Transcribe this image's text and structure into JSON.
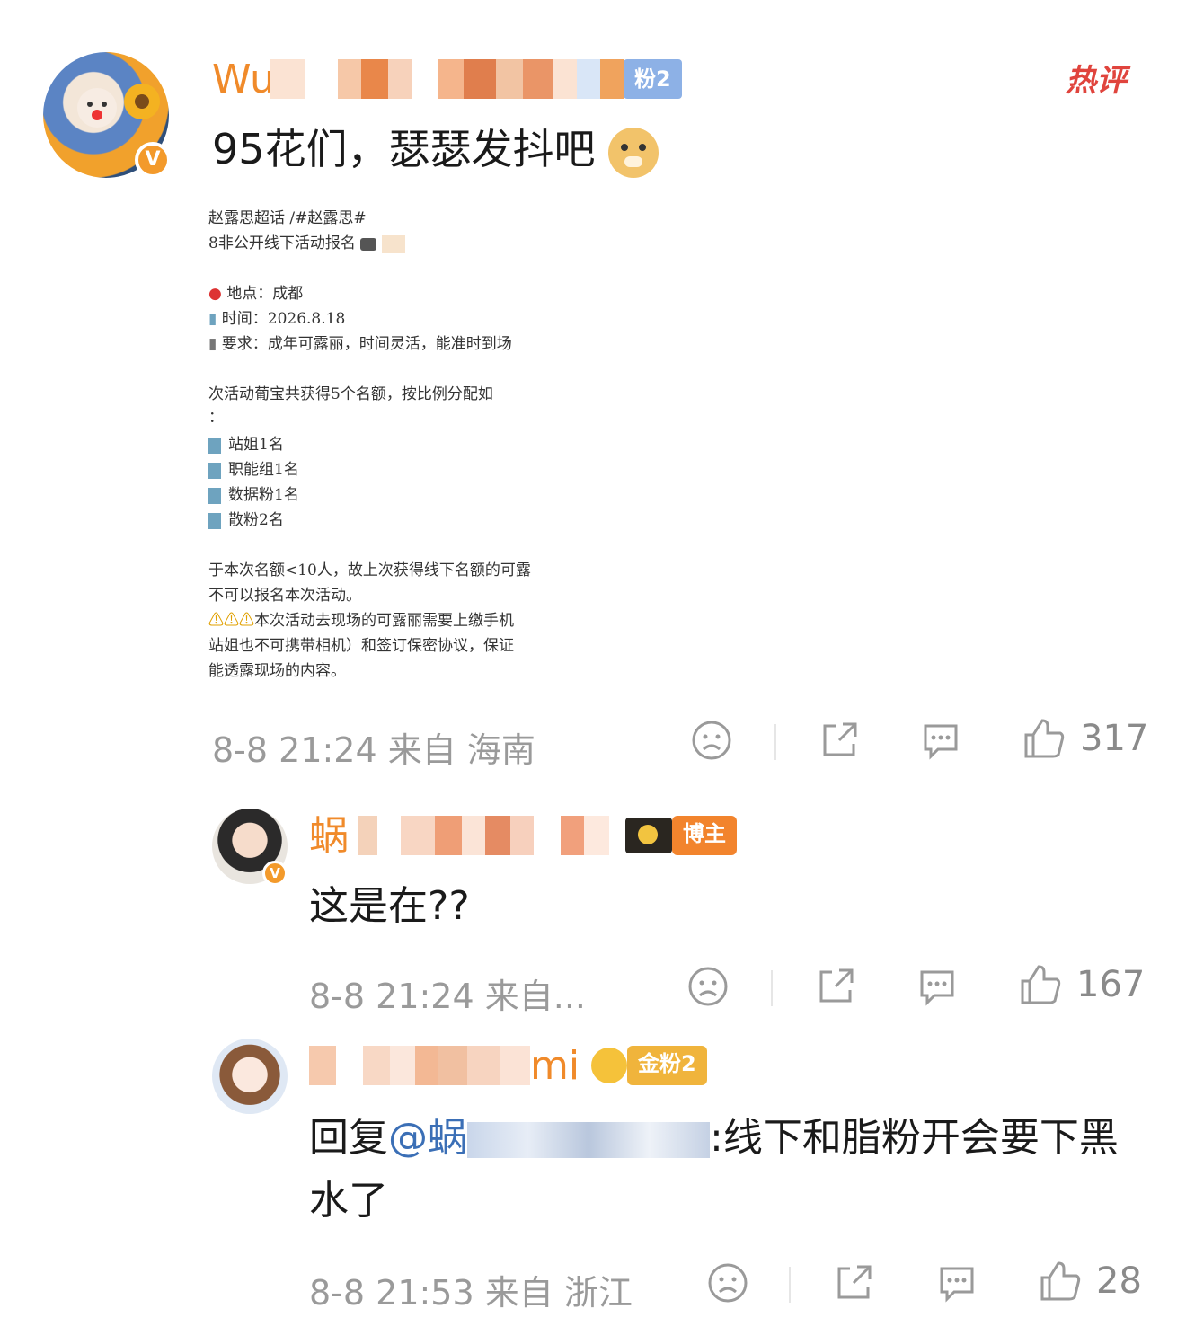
{
  "hot_tag": "热评",
  "post": {
    "username_visible_prefix": "Wu",
    "fan_badge": "粉2",
    "text": "95花们，瑟瑟发抖吧",
    "emoji": "doge-emoji",
    "time": "8-8 21:24",
    "from": "来自 海南",
    "likes": "317",
    "image": {
      "line1": "赵露思超话  /#赵露思#",
      "line2": "8非公开线下活动报名",
      "items": [
        "地点：成都",
        "时间：2026.8.18",
        "要求：成年可露丽，时间灵活，能准时到场"
      ],
      "quota": "次活动葡宝共获得5个名额，按比例分配如",
      "quota2": "：",
      "groups": [
        "站姐1名",
        "职能组1名",
        "数据粉1名",
        "散粉2名"
      ],
      "note1": "于本次名额<10人，故上次获得线下名额的可露",
      "note2": "不可以报名本次活动。",
      "note3": "本次活动去现场的可露丽需要上缴手机",
      "note4": "站姐也不可携带相机）和签订保密协议，保证",
      "note5": "能透露现场的内容。"
    }
  },
  "reply1": {
    "username_visible_prefix": "蜗",
    "badge": "博主",
    "text": "这是在??",
    "time": "8-8 21:24",
    "from": "来自...",
    "likes": "167"
  },
  "reply2": {
    "username_visible_suffix": "mi",
    "badge": "金粉2",
    "reply_prefix": "回复",
    "mention": "@蜗",
    "text": ":线下和脂粉开会要下黑水了",
    "time": "8-8 21:53",
    "from": "来自 浙江",
    "likes": "28"
  },
  "colors": {
    "hot": "#e0443d",
    "name_orange": "#f08a2a",
    "meta_gray": "#9a9a9a",
    "mention_blue": "#3b6fb6"
  }
}
